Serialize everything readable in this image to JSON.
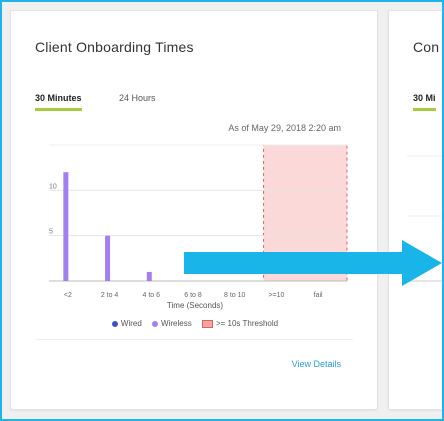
{
  "left_card": {
    "title": "Client Onboarding Times",
    "tabs": [
      {
        "label": "30 Minutes",
        "active": true
      },
      {
        "label": "24 Hours",
        "active": false
      }
    ],
    "as_of": "As of May 29, 2018 2:20 am",
    "view_details": "View Details"
  },
  "right_card": {
    "title": "Con",
    "tab": "30 Mi"
  },
  "chart_data": {
    "type": "bar",
    "categories": [
      "<2",
      "2 to 4",
      "4 to 6",
      "6 to 8",
      "8 to 10",
      ">=10",
      "fail"
    ],
    "series": [
      {
        "name": "Wired",
        "values": [
          0,
          0,
          0,
          0,
          0,
          0,
          0
        ],
        "color": "#3d52c8"
      },
      {
        "name": "Wireless",
        "values": [
          12,
          5,
          1,
          0,
          0,
          0,
          0
        ],
        "color": "#a47ff0"
      }
    ],
    "yticks": [
      5,
      10
    ],
    "ylim": [
      0,
      15
    ],
    "xlabel": "Time (Seconds)",
    "threshold": {
      "label": ">= 10s Threshold",
      "categories": [
        ">=10",
        "fail"
      ],
      "fill": "#fbd9d9",
      "stroke": "#e06060"
    },
    "grid": true
  },
  "colors": {
    "accent_tab": "#a4cc3c",
    "link": "#2a9fd6",
    "frame": "#1fb3ea",
    "overlay_arrow": "#19b4e8"
  },
  "icons": {
    "overlay": "right-arrow-icon"
  }
}
